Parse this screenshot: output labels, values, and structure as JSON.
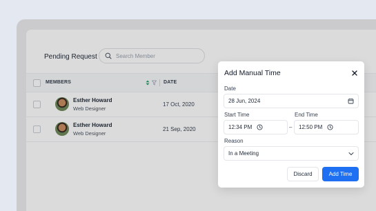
{
  "header": {
    "title": "Pending Request"
  },
  "search": {
    "placeholder": "Search Member"
  },
  "table": {
    "columns": {
      "members": "MEMBERS",
      "date": "DATE"
    },
    "rows": [
      {
        "name": "Esther Howard",
        "role": "Web Designer",
        "date": "17 Oct, 2020"
      },
      {
        "name": "Esther Howard",
        "role": "Web Designer",
        "date": "21 Sep, 2020"
      }
    ]
  },
  "modal": {
    "title": "Add Manual Time",
    "date_label": "Date",
    "date_value": "28 Jun, 2024",
    "start_label": "Start Time",
    "start_value": "12:34 PM",
    "end_label": "End Time",
    "end_value": "12:50 PM",
    "separator": "–",
    "reason_label": "Reason",
    "reason_value": "In a Meeting",
    "discard_label": "Discard",
    "add_label": "Add Time"
  },
  "colors": {
    "accent": "#1e6ff2",
    "backdrop": "#e3e8f1",
    "sort_icon": "#22a06b"
  },
  "icons": [
    "search-icon",
    "sort-icon",
    "filter-icon",
    "close-icon",
    "calendar-icon",
    "clock-icon",
    "chevron-down-icon"
  ]
}
